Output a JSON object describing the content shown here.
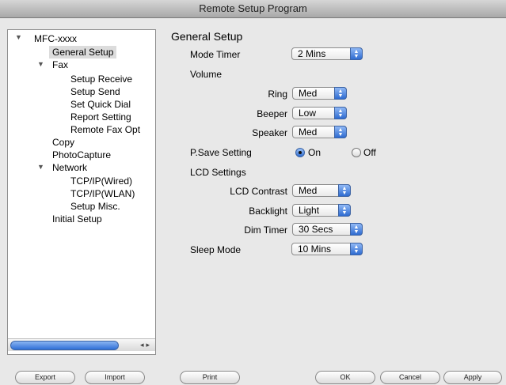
{
  "window": {
    "title": "Remote Setup Program"
  },
  "tree": {
    "root": "MFC-xxxx",
    "items": [
      {
        "label": "General Setup"
      },
      {
        "label": "Fax"
      },
      {
        "label": "Setup Receive"
      },
      {
        "label": "Setup Send"
      },
      {
        "label": "Set Quick Dial"
      },
      {
        "label": "Report Setting"
      },
      {
        "label": "Remote Fax Opt"
      },
      {
        "label": "Copy"
      },
      {
        "label": "PhotoCapture"
      },
      {
        "label": "Network"
      },
      {
        "label": "TCP/IP(Wired)"
      },
      {
        "label": "TCP/IP(WLAN)"
      },
      {
        "label": "Setup Misc."
      },
      {
        "label": "Initial Setup"
      }
    ]
  },
  "panel": {
    "title": "General Setup",
    "mode_timer": {
      "label": "Mode Timer",
      "value": "2 Mins"
    },
    "volume": {
      "label": "Volume"
    },
    "ring": {
      "label": "Ring",
      "value": "Med"
    },
    "beeper": {
      "label": "Beeper",
      "value": "Low"
    },
    "speaker": {
      "label": "Speaker",
      "value": "Med"
    },
    "psave": {
      "label": "P.Save Setting",
      "on": "On",
      "off": "Off",
      "selected": "On"
    },
    "lcd": {
      "label": "LCD Settings"
    },
    "lcd_contrast": {
      "label": "LCD Contrast",
      "value": "Med"
    },
    "backlight": {
      "label": "Backlight",
      "value": "Light"
    },
    "dim_timer": {
      "label": "Dim Timer",
      "value": "30 Secs"
    },
    "sleep_mode": {
      "label": "Sleep Mode",
      "value": "10 Mins"
    }
  },
  "buttons": {
    "export": "Export",
    "import": "Import",
    "print": "Print",
    "ok": "OK",
    "cancel": "Cancel",
    "apply": "Apply"
  }
}
